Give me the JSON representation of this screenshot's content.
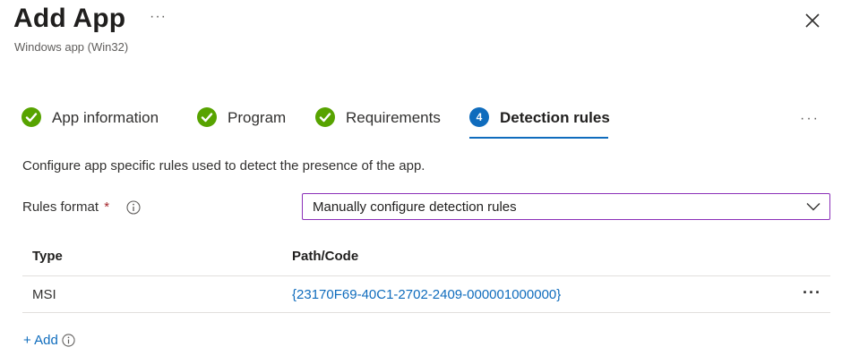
{
  "header": {
    "title": "Add App",
    "more_label": "···",
    "subtitle": "Windows app (Win32)"
  },
  "steps": [
    {
      "label": "App information",
      "state": "complete"
    },
    {
      "label": "Program",
      "state": "complete"
    },
    {
      "label": "Requirements",
      "state": "complete"
    },
    {
      "label": "Detection rules",
      "state": "active",
      "number": "4"
    }
  ],
  "steps_more": "···",
  "description": "Configure app specific rules used to detect the presence of the app.",
  "rules_format": {
    "label": "Rules format",
    "required_mark": "*",
    "selected": "Manually configure detection rules"
  },
  "table": {
    "headers": {
      "type": "Type",
      "path": "Path/Code"
    },
    "rows": [
      {
        "type": "MSI",
        "path": "{23170F69-40C1-2702-2409-000001000000}",
        "more": "···"
      }
    ]
  },
  "add_label": "+ Add",
  "colors": {
    "complete_green": "#57a300",
    "active_blue": "#0f6cbd",
    "link_blue": "#0f6cbd",
    "select_border": "#8a2fb8",
    "required_red": "#a4262c"
  },
  "icons": {
    "close": "close-icon",
    "check": "check-circle-icon",
    "info": "info-icon",
    "chevron": "chevron-down-icon"
  }
}
